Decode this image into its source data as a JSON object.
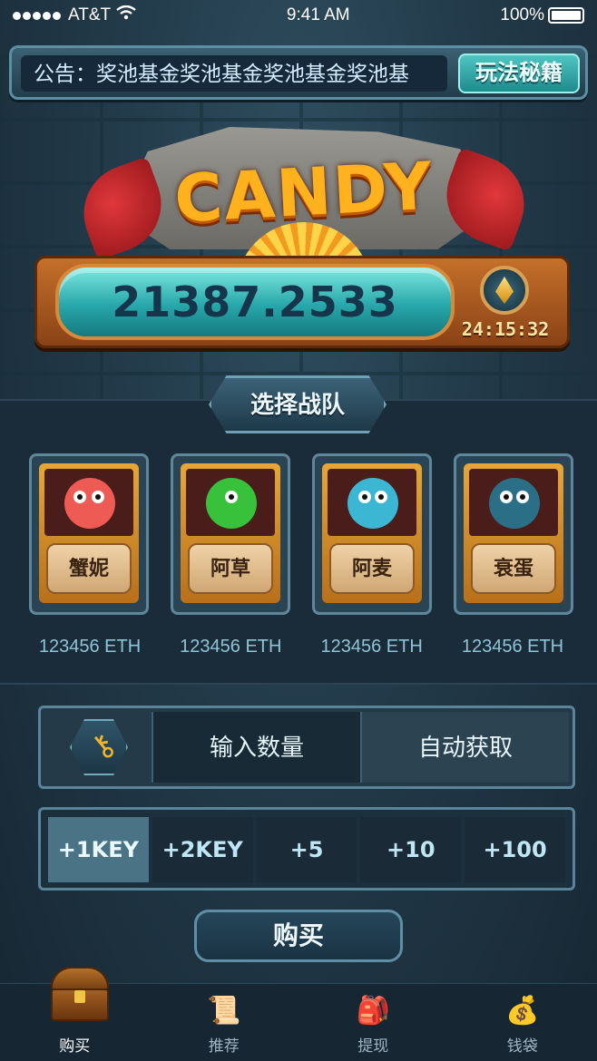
{
  "status_bar": {
    "carrier": "AT&T",
    "time": "9:41 AM",
    "battery": "100%"
  },
  "notice": {
    "text": "公告：奖池基金奖池基金奖池基金奖池基",
    "rules_button": "玩法秘籍"
  },
  "logo": {
    "text": "CANDY"
  },
  "pot": {
    "value": "21387.2533",
    "timer": "24:15:32"
  },
  "team": {
    "title": "选择战队",
    "cards": [
      {
        "name": "蟹妮",
        "eth": "123456 ETH",
        "color": "#ee5a54"
      },
      {
        "name": "阿草",
        "eth": "123456 ETH",
        "color": "#38c23b"
      },
      {
        "name": "阿麦",
        "eth": "123456 ETH",
        "color": "#3bb7d4"
      },
      {
        "name": "衰蛋",
        "eth": "123456 ETH",
        "color": "#2b6f87"
      }
    ]
  },
  "purchase": {
    "key_icon": "key-icon",
    "quantity_label": "输入数量",
    "auto_label": "自动获取",
    "options": [
      "+1KEY",
      "+2KEY",
      "+5",
      "+10",
      "+100"
    ],
    "active_option": 0,
    "buy_label": "购买"
  },
  "tabbar": {
    "items": [
      {
        "label": "购买",
        "icon": "treasure-chest-icon"
      },
      {
        "label": "推荐",
        "icon": "scroll-icon"
      },
      {
        "label": "提现",
        "icon": "backpack-icon"
      },
      {
        "label": "钱袋",
        "icon": "money-bag-icon"
      }
    ],
    "active": 0
  }
}
